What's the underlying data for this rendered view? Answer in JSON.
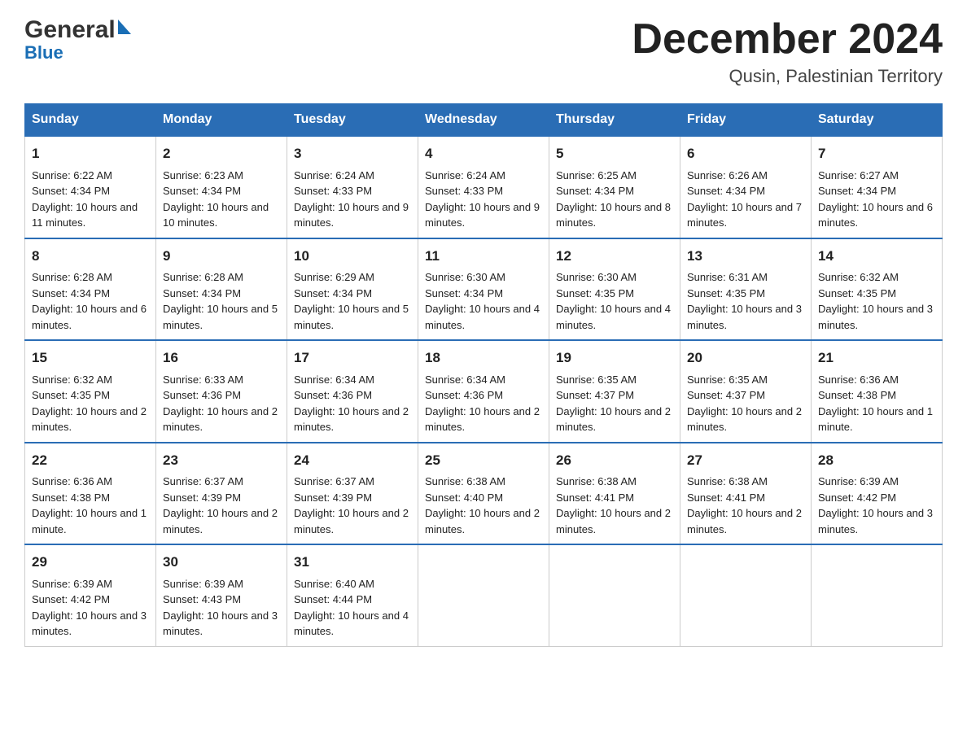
{
  "header": {
    "logo_general": "General",
    "logo_blue": "Blue",
    "title": "December 2024",
    "subtitle": "Qusin, Palestinian Territory"
  },
  "days_of_week": [
    "Sunday",
    "Monday",
    "Tuesday",
    "Wednesday",
    "Thursday",
    "Friday",
    "Saturday"
  ],
  "weeks": [
    [
      {
        "day": "1",
        "sunrise": "Sunrise: 6:22 AM",
        "sunset": "Sunset: 4:34 PM",
        "daylight": "Daylight: 10 hours and 11 minutes."
      },
      {
        "day": "2",
        "sunrise": "Sunrise: 6:23 AM",
        "sunset": "Sunset: 4:34 PM",
        "daylight": "Daylight: 10 hours and 10 minutes."
      },
      {
        "day": "3",
        "sunrise": "Sunrise: 6:24 AM",
        "sunset": "Sunset: 4:33 PM",
        "daylight": "Daylight: 10 hours and 9 minutes."
      },
      {
        "day": "4",
        "sunrise": "Sunrise: 6:24 AM",
        "sunset": "Sunset: 4:33 PM",
        "daylight": "Daylight: 10 hours and 9 minutes."
      },
      {
        "day": "5",
        "sunrise": "Sunrise: 6:25 AM",
        "sunset": "Sunset: 4:34 PM",
        "daylight": "Daylight: 10 hours and 8 minutes."
      },
      {
        "day": "6",
        "sunrise": "Sunrise: 6:26 AM",
        "sunset": "Sunset: 4:34 PM",
        "daylight": "Daylight: 10 hours and 7 minutes."
      },
      {
        "day": "7",
        "sunrise": "Sunrise: 6:27 AM",
        "sunset": "Sunset: 4:34 PM",
        "daylight": "Daylight: 10 hours and 6 minutes."
      }
    ],
    [
      {
        "day": "8",
        "sunrise": "Sunrise: 6:28 AM",
        "sunset": "Sunset: 4:34 PM",
        "daylight": "Daylight: 10 hours and 6 minutes."
      },
      {
        "day": "9",
        "sunrise": "Sunrise: 6:28 AM",
        "sunset": "Sunset: 4:34 PM",
        "daylight": "Daylight: 10 hours and 5 minutes."
      },
      {
        "day": "10",
        "sunrise": "Sunrise: 6:29 AM",
        "sunset": "Sunset: 4:34 PM",
        "daylight": "Daylight: 10 hours and 5 minutes."
      },
      {
        "day": "11",
        "sunrise": "Sunrise: 6:30 AM",
        "sunset": "Sunset: 4:34 PM",
        "daylight": "Daylight: 10 hours and 4 minutes."
      },
      {
        "day": "12",
        "sunrise": "Sunrise: 6:30 AM",
        "sunset": "Sunset: 4:35 PM",
        "daylight": "Daylight: 10 hours and 4 minutes."
      },
      {
        "day": "13",
        "sunrise": "Sunrise: 6:31 AM",
        "sunset": "Sunset: 4:35 PM",
        "daylight": "Daylight: 10 hours and 3 minutes."
      },
      {
        "day": "14",
        "sunrise": "Sunrise: 6:32 AM",
        "sunset": "Sunset: 4:35 PM",
        "daylight": "Daylight: 10 hours and 3 minutes."
      }
    ],
    [
      {
        "day": "15",
        "sunrise": "Sunrise: 6:32 AM",
        "sunset": "Sunset: 4:35 PM",
        "daylight": "Daylight: 10 hours and 2 minutes."
      },
      {
        "day": "16",
        "sunrise": "Sunrise: 6:33 AM",
        "sunset": "Sunset: 4:36 PM",
        "daylight": "Daylight: 10 hours and 2 minutes."
      },
      {
        "day": "17",
        "sunrise": "Sunrise: 6:34 AM",
        "sunset": "Sunset: 4:36 PM",
        "daylight": "Daylight: 10 hours and 2 minutes."
      },
      {
        "day": "18",
        "sunrise": "Sunrise: 6:34 AM",
        "sunset": "Sunset: 4:36 PM",
        "daylight": "Daylight: 10 hours and 2 minutes."
      },
      {
        "day": "19",
        "sunrise": "Sunrise: 6:35 AM",
        "sunset": "Sunset: 4:37 PM",
        "daylight": "Daylight: 10 hours and 2 minutes."
      },
      {
        "day": "20",
        "sunrise": "Sunrise: 6:35 AM",
        "sunset": "Sunset: 4:37 PM",
        "daylight": "Daylight: 10 hours and 2 minutes."
      },
      {
        "day": "21",
        "sunrise": "Sunrise: 6:36 AM",
        "sunset": "Sunset: 4:38 PM",
        "daylight": "Daylight: 10 hours and 1 minute."
      }
    ],
    [
      {
        "day": "22",
        "sunrise": "Sunrise: 6:36 AM",
        "sunset": "Sunset: 4:38 PM",
        "daylight": "Daylight: 10 hours and 1 minute."
      },
      {
        "day": "23",
        "sunrise": "Sunrise: 6:37 AM",
        "sunset": "Sunset: 4:39 PM",
        "daylight": "Daylight: 10 hours and 2 minutes."
      },
      {
        "day": "24",
        "sunrise": "Sunrise: 6:37 AM",
        "sunset": "Sunset: 4:39 PM",
        "daylight": "Daylight: 10 hours and 2 minutes."
      },
      {
        "day": "25",
        "sunrise": "Sunrise: 6:38 AM",
        "sunset": "Sunset: 4:40 PM",
        "daylight": "Daylight: 10 hours and 2 minutes."
      },
      {
        "day": "26",
        "sunrise": "Sunrise: 6:38 AM",
        "sunset": "Sunset: 4:41 PM",
        "daylight": "Daylight: 10 hours and 2 minutes."
      },
      {
        "day": "27",
        "sunrise": "Sunrise: 6:38 AM",
        "sunset": "Sunset: 4:41 PM",
        "daylight": "Daylight: 10 hours and 2 minutes."
      },
      {
        "day": "28",
        "sunrise": "Sunrise: 6:39 AM",
        "sunset": "Sunset: 4:42 PM",
        "daylight": "Daylight: 10 hours and 3 minutes."
      }
    ],
    [
      {
        "day": "29",
        "sunrise": "Sunrise: 6:39 AM",
        "sunset": "Sunset: 4:42 PM",
        "daylight": "Daylight: 10 hours and 3 minutes."
      },
      {
        "day": "30",
        "sunrise": "Sunrise: 6:39 AM",
        "sunset": "Sunset: 4:43 PM",
        "daylight": "Daylight: 10 hours and 3 minutes."
      },
      {
        "day": "31",
        "sunrise": "Sunrise: 6:40 AM",
        "sunset": "Sunset: 4:44 PM",
        "daylight": "Daylight: 10 hours and 4 minutes."
      },
      {
        "day": "",
        "sunrise": "",
        "sunset": "",
        "daylight": ""
      },
      {
        "day": "",
        "sunrise": "",
        "sunset": "",
        "daylight": ""
      },
      {
        "day": "",
        "sunrise": "",
        "sunset": "",
        "daylight": ""
      },
      {
        "day": "",
        "sunrise": "",
        "sunset": "",
        "daylight": ""
      }
    ]
  ]
}
